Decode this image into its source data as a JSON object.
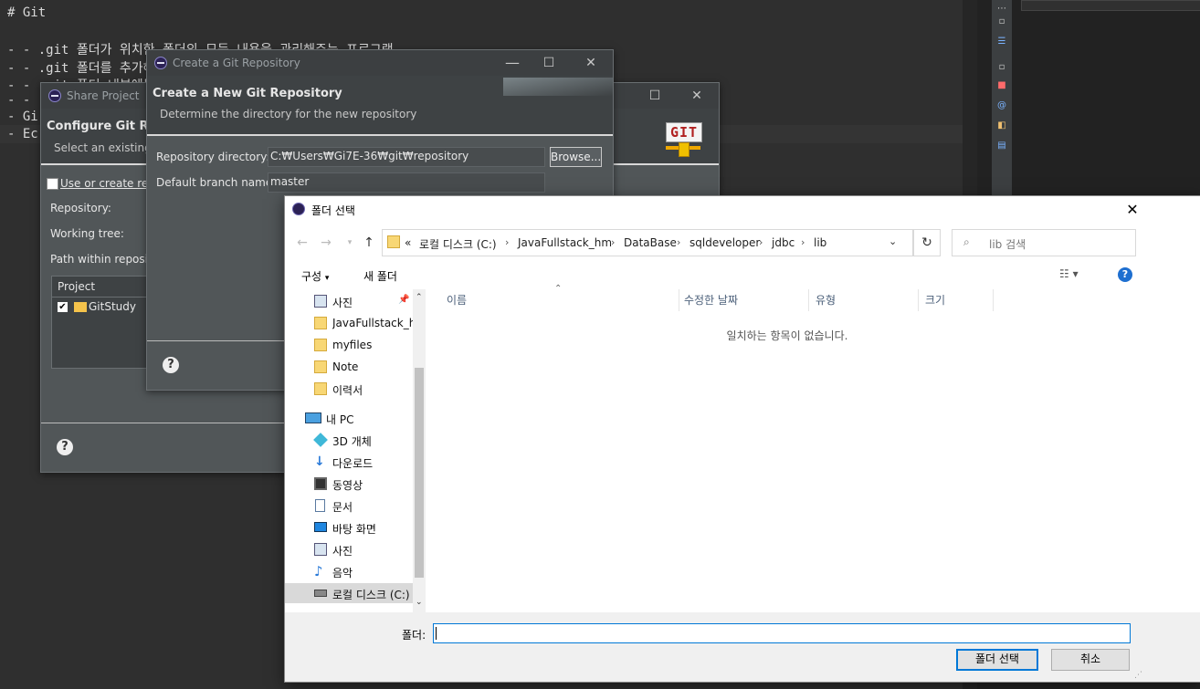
{
  "editor": {
    "lines": [
      "# Git",
      "",
      "- - .git 폴더가 위치한 폴더의 모든 내용을 관리해주는 프로그램",
      "- - .git 폴더를 추가해",
      "- - .git 폴더 내부에는",
      "- - .g",
      "- Gi",
      "- Ec"
    ]
  },
  "share_project": {
    "title": "Share Project",
    "heading": "Configure Git Repo",
    "subheading": "Select an existing r",
    "use_checkbox_label": "Use or create repo",
    "repository_label": "Repository:",
    "working_tree_label": "Working tree:",
    "path_label": "Path within reposito",
    "project_col": "Project",
    "project_item": "GitStudy"
  },
  "create_repo": {
    "title": "Create a Git Repository",
    "heading": "Create a New Git Repository",
    "subheading": "Determine the directory for the new repository",
    "repo_dir_label": "Repository directory:",
    "repo_dir_value": "C:₩Users₩Gi7E-36₩git₩repository",
    "browse_label": "Browse...",
    "branch_label": "Default branch name:",
    "branch_value": "master",
    "logo_text": "GIT"
  },
  "folder_dialog": {
    "title": "폴더 선택",
    "breadcrumb": [
      "«",
      "로컬 디스크 (C:)",
      "JavaFullstack_hm",
      "DataBase",
      "sqldeveloper",
      "jdbc",
      "lib"
    ],
    "search_placeholder": "lib 검색",
    "organize_label": "구성",
    "new_folder_label": "새 폴더",
    "sidebar": [
      {
        "label": "사진",
        "icon": "pictures-icon"
      },
      {
        "label": "JavaFullstack_hm",
        "icon": "folder-icon"
      },
      {
        "label": "myfiles",
        "icon": "folder-icon"
      },
      {
        "label": "Note",
        "icon": "folder-icon"
      },
      {
        "label": "이력서",
        "icon": "folder-icon"
      },
      {
        "label": "내 PC",
        "icon": "pc-icon"
      },
      {
        "label": "3D 개체",
        "icon": "3d-objects-icon"
      },
      {
        "label": "다운로드",
        "icon": "download-icon"
      },
      {
        "label": "동영상",
        "icon": "video-icon"
      },
      {
        "label": "문서",
        "icon": "document-icon"
      },
      {
        "label": "바탕 화면",
        "icon": "desktop-icon"
      },
      {
        "label": "사진",
        "icon": "pictures-icon"
      },
      {
        "label": "음악",
        "icon": "music-icon"
      },
      {
        "label": "로컬 디스크 (C:)",
        "icon": "drive-icon"
      }
    ],
    "columns": [
      "이름",
      "수정한 날짜",
      "유형",
      "크기"
    ],
    "empty_message": "일치하는 항목이 없습니다.",
    "folder_label": "폴더:",
    "folder_value": "",
    "select_button": "폴더 선택",
    "cancel_button": "취소"
  },
  "colors": {
    "eclipse_dialog": "#515658",
    "accent_blue": "#0078d7",
    "folder_yellow": "#f8d775"
  }
}
